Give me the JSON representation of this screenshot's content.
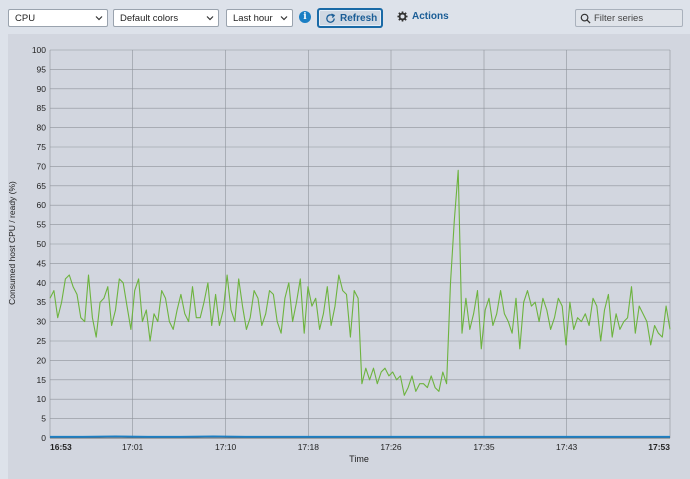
{
  "toolbar": {
    "metric_select": "CPU",
    "colors_select": "Default colors",
    "range_select": "Last hour",
    "refresh_label": "Refresh",
    "actions_label": "Actions",
    "filter_placeholder": "Filter series"
  },
  "chart_data": {
    "type": "line",
    "xlabel": "Time",
    "ylabel": "Consumed host CPU / ready (%)",
    "ylim": [
      0,
      100
    ],
    "yticks": [
      0,
      5,
      10,
      15,
      20,
      25,
      30,
      35,
      40,
      45,
      50,
      55,
      60,
      65,
      70,
      75,
      80,
      85,
      90,
      95,
      100
    ],
    "xticks": [
      "16:53",
      "17:01",
      "17:10",
      "17:18",
      "17:26",
      "17:35",
      "17:43",
      "17:53"
    ],
    "grid": true,
    "series": [
      {
        "color": "#6db33f",
        "values": [
          36,
          38,
          31,
          35,
          41,
          42,
          39,
          37,
          31,
          30,
          42,
          31,
          26,
          35,
          36,
          39,
          29,
          33,
          41,
          40,
          34,
          28,
          38,
          41,
          30,
          33,
          25,
          32,
          30,
          38,
          36,
          30,
          28,
          33,
          37,
          32,
          30,
          39,
          31,
          31,
          35,
          40,
          29,
          37,
          29,
          33,
          42,
          33,
          30,
          41,
          34,
          28,
          31,
          38,
          36,
          29,
          32,
          38,
          37,
          30,
          27,
          36,
          40,
          30,
          35,
          41,
          27,
          39,
          34,
          36,
          28,
          32,
          39,
          29,
          34,
          42,
          38,
          37,
          26,
          38,
          36,
          14,
          18,
          15,
          18,
          14,
          17,
          18,
          16,
          17,
          15,
          16,
          11,
          13,
          16,
          12,
          14,
          14,
          13,
          16,
          13,
          12,
          17,
          14,
          40,
          56,
          69,
          27,
          36,
          28,
          32,
          38,
          23,
          33,
          36,
          29,
          32,
          38,
          32,
          30,
          27,
          36,
          23,
          35,
          38,
          34,
          35,
          30,
          36,
          33,
          28,
          31,
          36,
          34,
          24,
          35,
          28,
          31,
          30,
          32,
          29,
          36,
          34,
          25,
          33,
          37,
          26,
          32,
          28,
          30,
          31,
          39,
          27,
          34,
          32,
          30,
          24,
          29,
          27,
          26,
          34,
          28
        ],
        "xrange": [
          "16:53",
          "17:53"
        ]
      },
      {
        "color": "#1b7fc4",
        "values": [
          0.3,
          0.3,
          0.4,
          0.3,
          0.3,
          0.4,
          0.3,
          0.3,
          0.3,
          0.3,
          0.3,
          0.3,
          0.3,
          0.3,
          0.3,
          0.3,
          0.3,
          0.3,
          0.3,
          0.3
        ],
        "xrange": [
          "16:53",
          "17:53"
        ]
      }
    ]
  }
}
